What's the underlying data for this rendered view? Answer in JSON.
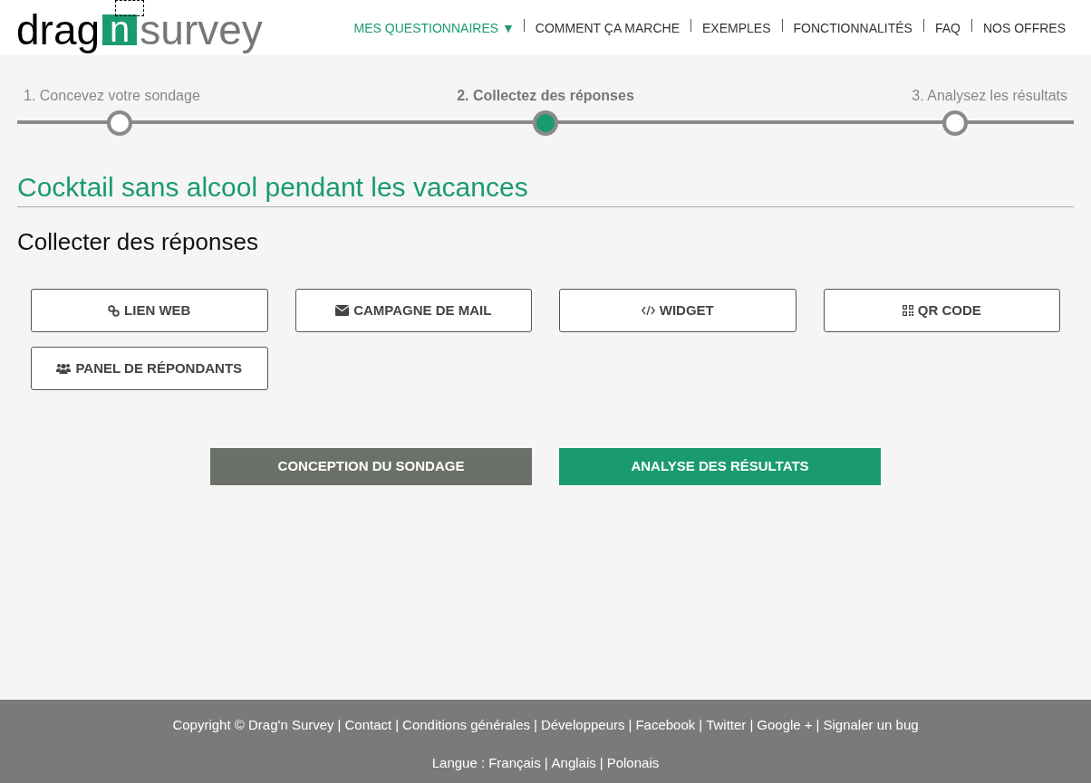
{
  "logo": {
    "part_1": "drag",
    "part_2": "n",
    "part_3": "survey"
  },
  "nav": [
    {
      "label": "MES QUESTIONNAIRES ▼",
      "selected": true
    },
    {
      "label": "COMMENT ÇA MARCHE",
      "selected": false
    },
    {
      "label": "EXEMPLES",
      "selected": false
    },
    {
      "label": "FONCTIONNALITÉS",
      "selected": false
    },
    {
      "label": "FAQ",
      "selected": false
    },
    {
      "label": "NOS OFFRES",
      "selected": false
    }
  ],
  "steps": [
    {
      "label": "1. Concevez votre sondage",
      "selected": false
    },
    {
      "label": "2. Collectez des réponses",
      "selected": true
    },
    {
      "label": "3. Analysez les résultats",
      "selected": false
    }
  ],
  "survey_title": "Cocktail sans alcool pendant les vacances",
  "section_title": "Collecter des réponses",
  "channels": [
    {
      "label": "LIEN WEB",
      "kind": "link"
    },
    {
      "label": "CAMPAGNE DE MAIL",
      "kind": "mail"
    },
    {
      "label": "WIDGET",
      "kind": "code"
    },
    {
      "label": "QR CODE",
      "kind": "qr"
    },
    {
      "label": "PANEL DE RÉPONDANTS",
      "kind": "users"
    }
  ],
  "actions": [
    {
      "label": "CONCEPTION DU SONDAGE",
      "kind": "secondary"
    },
    {
      "label": "ANALYSE DES RÉSULTATS",
      "kind": "primary"
    }
  ],
  "footer": {
    "separator": "|",
    "copyright": "Copyright © Drag'n Survey",
    "links": [
      "Contact",
      "Conditions générales",
      "Développeurs",
      "Facebook",
      "Twitter",
      "Google +",
      "Signaler un bug"
    ],
    "language_label": "Langue :",
    "languages": [
      "Français",
      "Anglais",
      "Polonais"
    ]
  }
}
